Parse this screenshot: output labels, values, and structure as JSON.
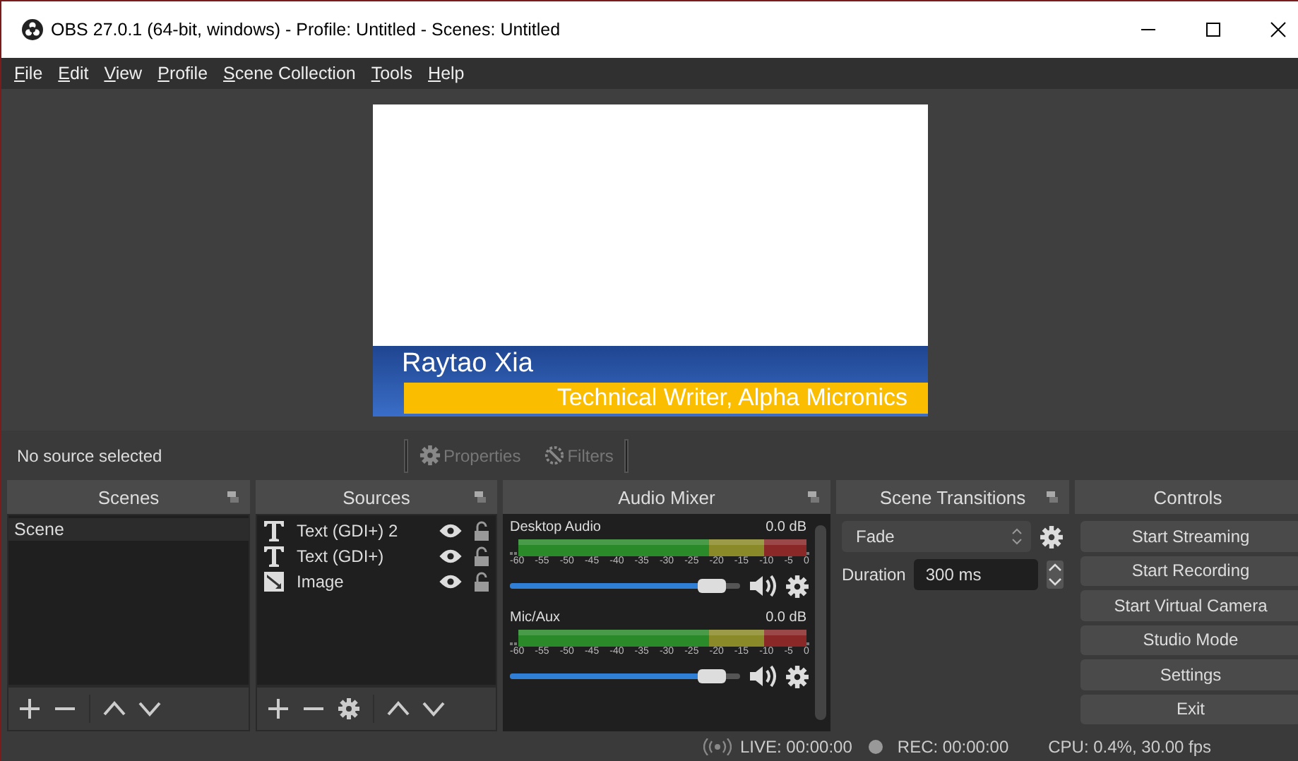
{
  "window": {
    "title": "OBS 27.0.1 (64-bit, windows) - Profile: Untitled - Scenes: Untitled"
  },
  "menu": [
    {
      "label": "File",
      "mnemonic": true
    },
    {
      "label": "Edit",
      "mnemonic": true
    },
    {
      "label": "View",
      "mnemonic": true
    },
    {
      "label": "Profile",
      "mnemonic": true
    },
    {
      "label": "Scene Collection",
      "mnemonic": true
    },
    {
      "label": "Tools",
      "mnemonic": true
    },
    {
      "label": "Help",
      "mnemonic": true
    }
  ],
  "preview": {
    "name": "Raytao Xia",
    "subtitle": "Technical Writer, Alpha Micronics"
  },
  "source_bar": {
    "status": "No source selected",
    "properties": "Properties",
    "filters": "Filters"
  },
  "scenes": {
    "title": "Scenes",
    "items": [
      {
        "label": "Scene",
        "selected": true
      }
    ]
  },
  "sources": {
    "title": "Sources",
    "items": [
      {
        "label": "Text (GDI+) 2",
        "kind": "text",
        "visible": true,
        "locked": false
      },
      {
        "label": "Text (GDI+)",
        "kind": "text",
        "visible": true,
        "locked": false
      },
      {
        "label": "Image",
        "kind": "image",
        "visible": true,
        "locked": false
      }
    ]
  },
  "audio_mixer": {
    "title": "Audio Mixer",
    "channels": [
      {
        "name": "Desktop Audio",
        "reading": "0.0 dB",
        "level": 0.9,
        "muted": false,
        "scale": [
          "-60",
          "-55",
          "-50",
          "-45",
          "-40",
          "-35",
          "-30",
          "-25",
          "-20",
          "-15",
          "-10",
          "-5",
          "0"
        ]
      },
      {
        "name": "Mic/Aux",
        "reading": "0.0 dB",
        "level": 0.9,
        "muted": false,
        "scale": [
          "-60",
          "-55",
          "-50",
          "-45",
          "-40",
          "-35",
          "-30",
          "-25",
          "-20",
          "-15",
          "-10",
          "-5",
          "0"
        ]
      }
    ]
  },
  "scene_transitions": {
    "title": "Scene Transitions",
    "transition": "Fade",
    "duration_label": "Duration",
    "duration": "300 ms"
  },
  "controls": {
    "title": "Controls",
    "buttons": [
      "Start Streaming",
      "Start Recording",
      "Start Virtual Camera",
      "Studio Mode",
      "Settings",
      "Exit"
    ]
  },
  "status_bar": {
    "live": "LIVE: 00:00:00",
    "rec": "REC: 00:00:00",
    "cpu": "CPU: 0.4%, 30.00 fps"
  }
}
